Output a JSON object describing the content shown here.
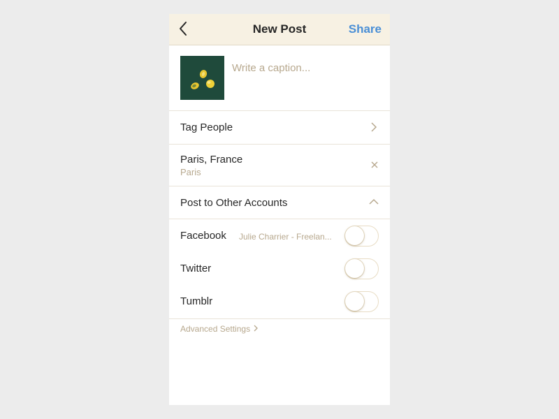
{
  "header": {
    "title": "New Post",
    "share_label": "Share",
    "back_icon": "chevron-left-icon"
  },
  "caption": {
    "placeholder": "Write a caption..."
  },
  "tag_people": {
    "label": "Tag People"
  },
  "location": {
    "name": "Paris, France",
    "sub": "Paris"
  },
  "other_accounts": {
    "label": "Post to Other Accounts",
    "expanded": true,
    "accounts": [
      {
        "name": "Facebook",
        "detail": "Julie Charrier - Freelan...",
        "enabled": false
      },
      {
        "name": "Twitter",
        "detail": "",
        "enabled": false
      },
      {
        "name": "Tumblr",
        "detail": "",
        "enabled": false
      }
    ]
  },
  "advanced_settings": {
    "label": "Advanced Settings"
  },
  "colors": {
    "background": "#ececec",
    "navbar": "#f7f1e3",
    "accent": "#4a8fd6",
    "muted_text": "#b7a88e",
    "thumbnail_bg": "#1f4a3b"
  }
}
